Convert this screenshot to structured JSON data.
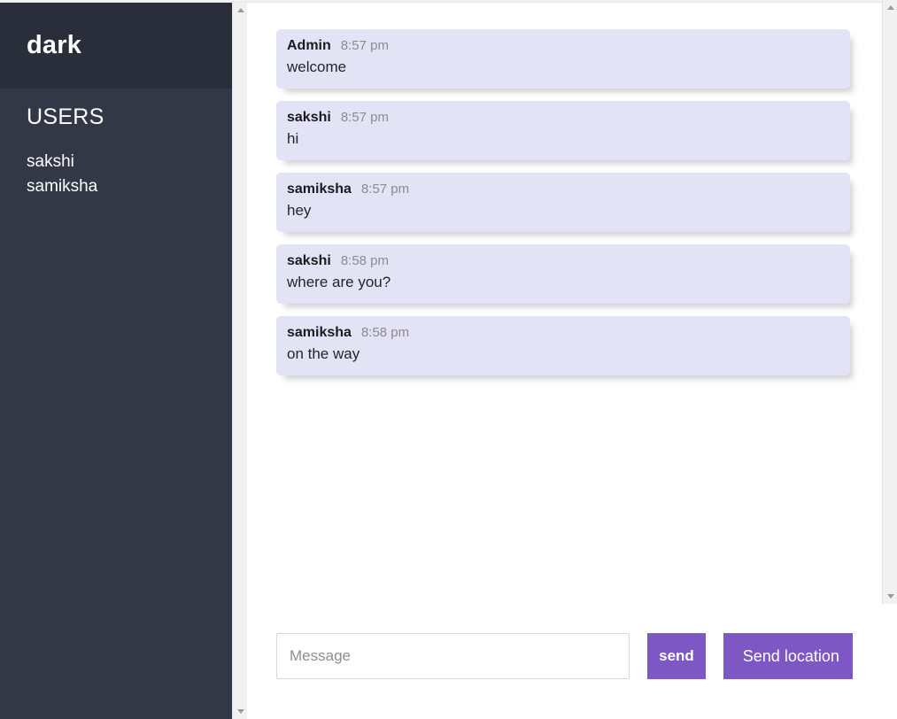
{
  "sidebar": {
    "room_title": "dark",
    "users_heading": "USERS",
    "users": [
      {
        "name": "sakshi"
      },
      {
        "name": "samiksha"
      }
    ]
  },
  "messages": [
    {
      "author": "Admin",
      "time": "8:57 pm",
      "text": "welcome"
    },
    {
      "author": "sakshi",
      "time": "8:57 pm",
      "text": "hi"
    },
    {
      "author": "samiksha",
      "time": "8:57 pm",
      "text": "hey"
    },
    {
      "author": "sakshi",
      "time": "8:58 pm",
      "text": "where are you?"
    },
    {
      "author": "samiksha",
      "time": "8:58 pm",
      "text": "on the way"
    }
  ],
  "composer": {
    "input_value": "",
    "input_placeholder": "Message",
    "send_label": "send",
    "send_location_label": "Send location"
  },
  "scrollbars": {
    "sidebar": {
      "up_icon": "triangle-up-icon",
      "down_icon": "triangle-down-icon"
    },
    "messages": {
      "up_icon": "triangle-up-icon",
      "down_icon": "triangle-down-icon"
    }
  },
  "colors": {
    "sidebar_body": "#333847",
    "sidebar_header": "#2a2d3a",
    "bubble": "#e3e3f6",
    "accent_purple": "#7d57c4",
    "author_text": "#1b1b1f",
    "time_text": "#8b8b93"
  }
}
